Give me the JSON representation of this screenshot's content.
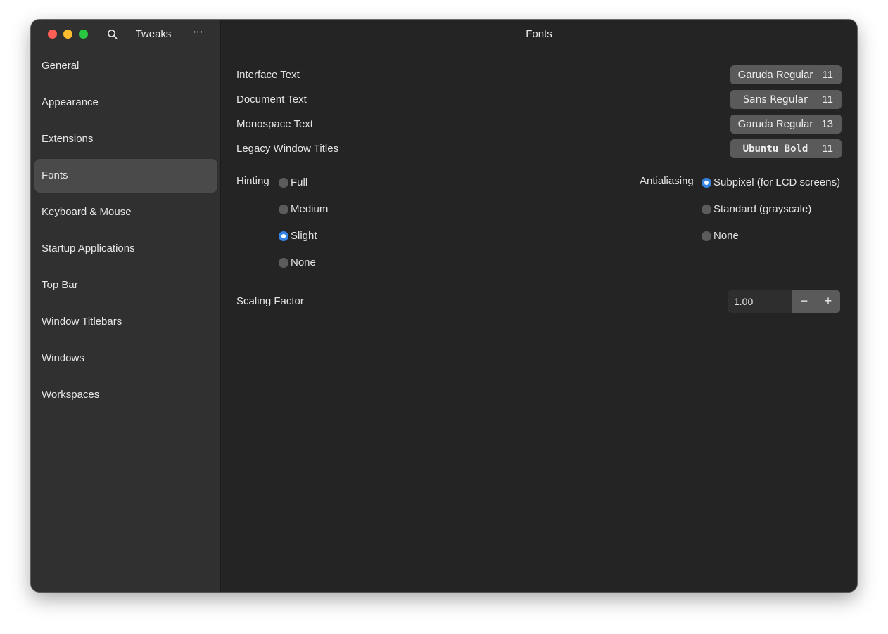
{
  "app": {
    "title": "Tweaks",
    "menu_icon": "⋯"
  },
  "sidebar": {
    "items": [
      {
        "label": "General"
      },
      {
        "label": "Appearance"
      },
      {
        "label": "Extensions"
      },
      {
        "label": "Fonts",
        "active": true
      },
      {
        "label": "Keyboard & Mouse"
      },
      {
        "label": "Startup Applications"
      },
      {
        "label": "Top Bar"
      },
      {
        "label": "Window Titlebars"
      },
      {
        "label": "Windows"
      },
      {
        "label": "Workspaces"
      }
    ]
  },
  "content": {
    "title": "Fonts",
    "fonts": [
      {
        "label": "Interface Text",
        "font": "Garuda Regular",
        "size": "11"
      },
      {
        "label": "Document Text",
        "font": "Sans Regular",
        "size": "11"
      },
      {
        "label": "Monospace Text",
        "font": "Garuda Regular",
        "size": "13"
      },
      {
        "label": "Legacy Window Titles",
        "font": "Ubuntu Bold",
        "size": "11"
      }
    ],
    "hinting": {
      "label": "Hinting",
      "options": [
        "Full",
        "Medium",
        "Slight",
        "None"
      ],
      "selected": "Slight"
    },
    "antialiasing": {
      "label": "Antialiasing",
      "options": [
        "Subpixel (for LCD screens)",
        "Standard (grayscale)",
        "None"
      ],
      "selected": "Subpixel (for LCD screens)"
    },
    "scaling": {
      "label": "Scaling Factor",
      "value": "1.00",
      "minus": "−",
      "plus": "+"
    }
  },
  "colors": {
    "accent": "#3584e4",
    "window_bg": "#242424",
    "sidebar_bg": "#303030",
    "traffic_close": "#ff5f57",
    "traffic_minimize": "#febc2e",
    "traffic_maximize": "#28c840"
  }
}
